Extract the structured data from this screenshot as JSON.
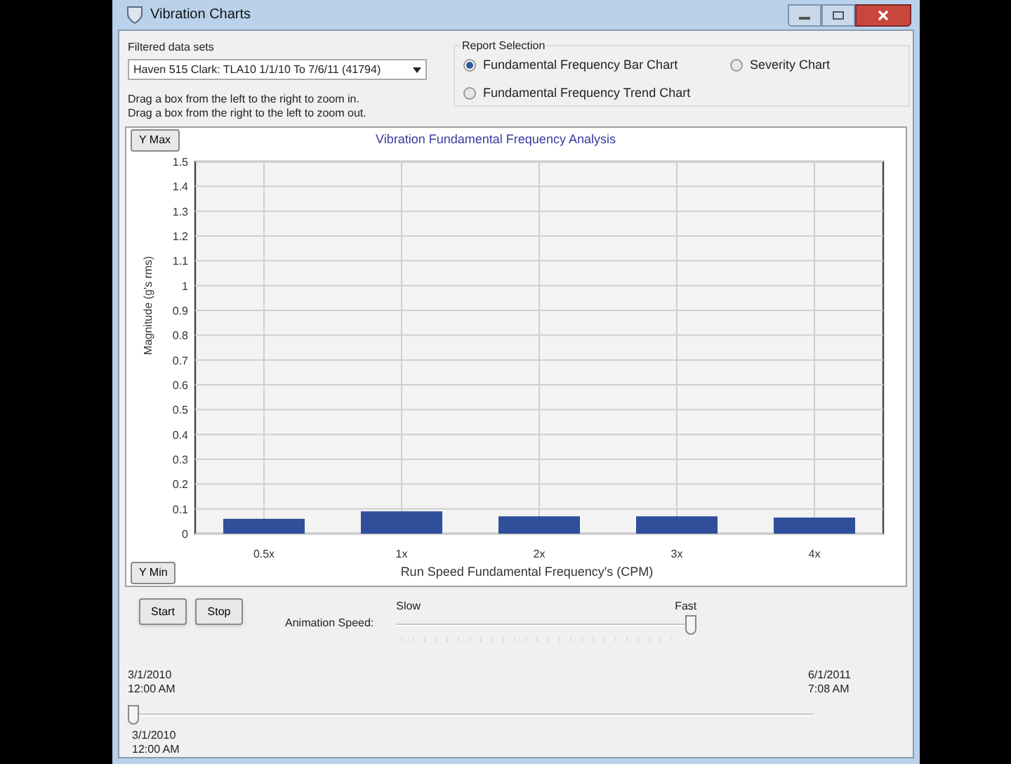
{
  "window": {
    "title": "Vibration Charts"
  },
  "filter": {
    "label": "Filtered data sets",
    "value": "Haven 515 Clark: TLA10 1/1/10 To 7/6/11 (41794)"
  },
  "hints": [
    "Drag a box from the left to the right to zoom in.",
    "Drag a box from the right to the left to zoom out."
  ],
  "report_selection": {
    "title": "Report Selection",
    "options": [
      {
        "label": "Fundamental Frequency Bar Chart",
        "selected": true
      },
      {
        "label": "Severity Chart",
        "selected": false
      },
      {
        "label": "Fundamental Frequency Trend Chart",
        "selected": false
      }
    ]
  },
  "chart": {
    "y_max_button": "Y Max",
    "y_min_button": "Y Min",
    "chart_data": {
      "type": "bar",
      "title": "Vibration Fundamental Frequency Analysis",
      "xlabel": "Run Speed Fundamental Frequency's (CPM)",
      "ylabel": "Magnitude (g's rms)",
      "categories": [
        "0.5x",
        "1x",
        "2x",
        "3x",
        "4x"
      ],
      "series": [
        {
          "color": "#2f4f9a",
          "values": [
            0.06,
            0.09,
            0.07,
            0.07,
            0.065
          ]
        }
      ],
      "grid": true,
      "ylim": [
        0,
        1.5
      ],
      "yticks": [
        0,
        0.1,
        0.2,
        0.3,
        0.4,
        0.5,
        0.6,
        0.7,
        0.8,
        0.9,
        1,
        1.1,
        1.2,
        1.3,
        1.4,
        1.5
      ]
    }
  },
  "animation": {
    "buttons": [
      "Start",
      "Stop"
    ],
    "label": "Animation Speed:",
    "min_label": "Slow",
    "max_label": "Fast",
    "level": 1
  },
  "timeline": {
    "start_label": "3/1/2010\n12:00 AM",
    "end_label": "6/1/2011\n7:08 AM",
    "level": 0,
    "current_label": "3/1/2010\n12:00 AM"
  }
}
